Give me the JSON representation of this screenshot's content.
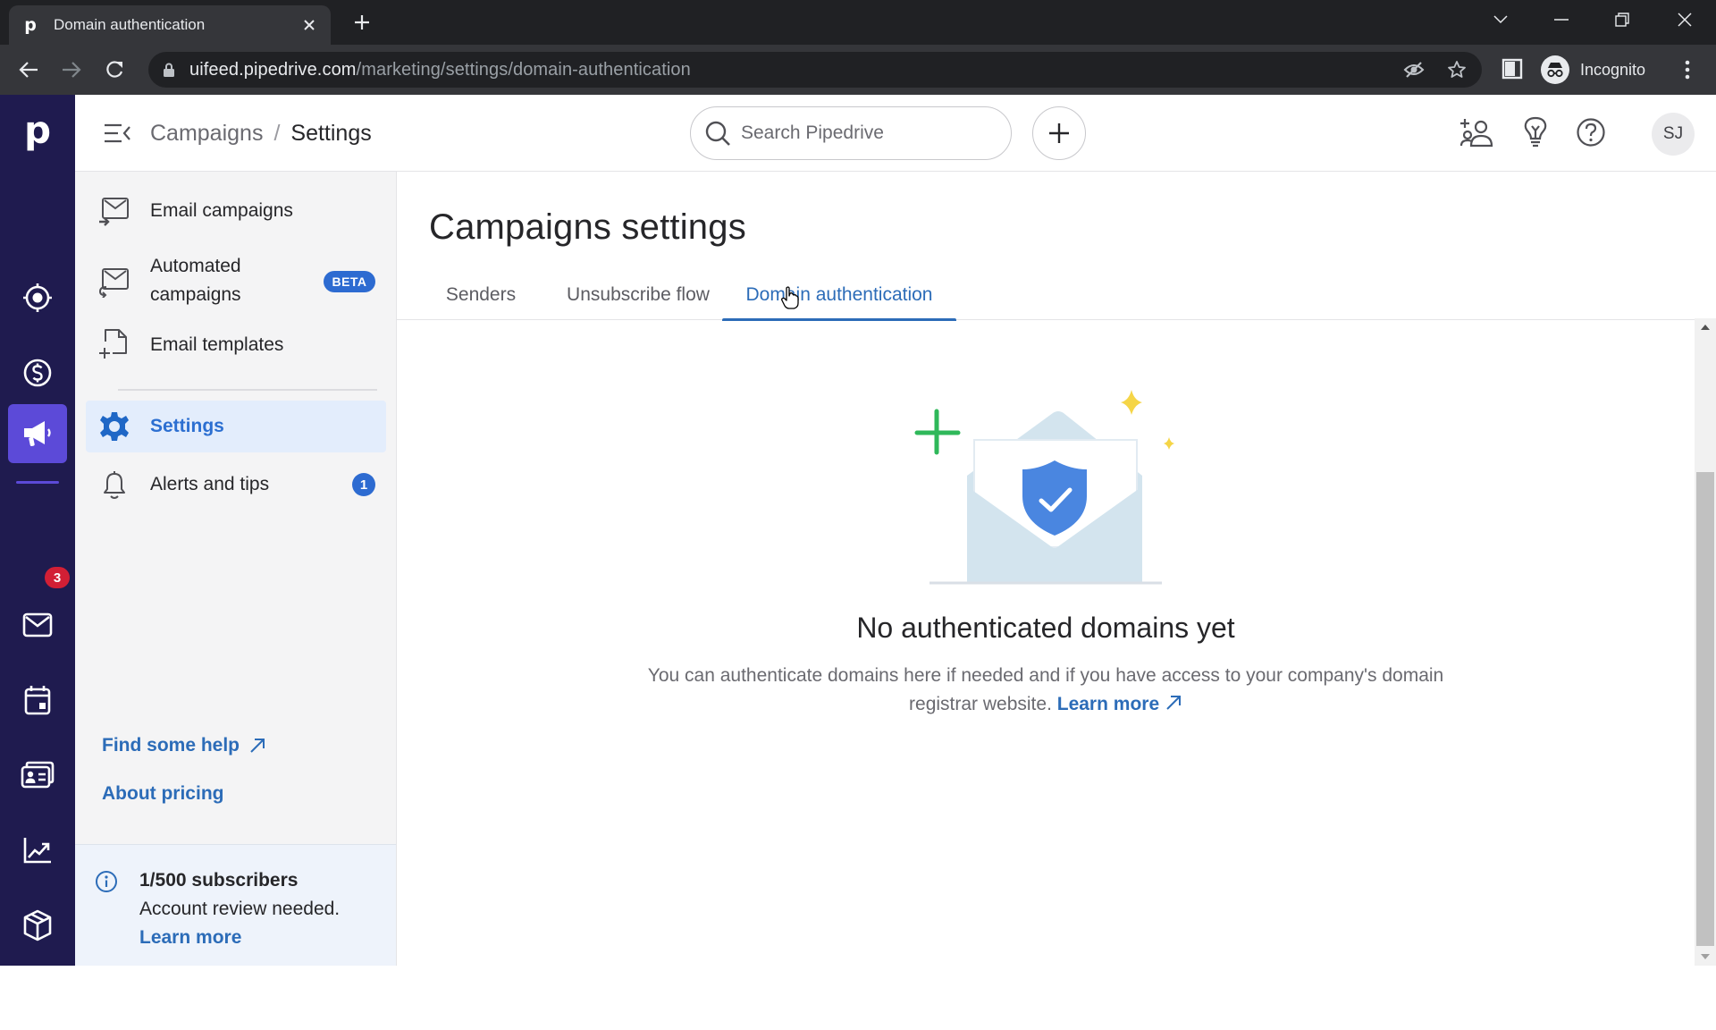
{
  "browser": {
    "tab_title": "Domain authentication",
    "tab_favicon": "p",
    "url_host": "uifeed.pipedrive.com",
    "url_path": "/marketing/settings/domain-authentication",
    "profile_label": "Incognito"
  },
  "appbar": {
    "breadcrumb_parent": "Campaigns",
    "breadcrumb_separator": "/",
    "breadcrumb_current": "Settings",
    "search_placeholder": "Search Pipedrive",
    "avatar_initials": "SJ"
  },
  "rail": {
    "logo": "p",
    "activities_badge": "3",
    "items": [
      {
        "name": "leads",
        "icon": "target-icon"
      },
      {
        "name": "deals",
        "icon": "dollar-icon"
      },
      {
        "name": "activities-tasks",
        "icon": "clipboard-check-icon"
      },
      {
        "name": "campaigns",
        "icon": "megaphone-icon",
        "active": true
      },
      {
        "name": "mail",
        "icon": "mail-icon"
      },
      {
        "name": "calendar",
        "icon": "calendar-icon"
      },
      {
        "name": "contacts",
        "icon": "contact-card-icon"
      },
      {
        "name": "insights",
        "icon": "chart-trend-icon"
      },
      {
        "name": "products",
        "icon": "box-icon"
      },
      {
        "name": "marketplace",
        "icon": "store-icon"
      }
    ]
  },
  "subnav": {
    "items": [
      {
        "label": "Email campaigns"
      },
      {
        "label": "Automated campaigns",
        "label_line1": "Automated",
        "label_line2": "campaigns",
        "badge": "BETA"
      },
      {
        "label": "Email templates"
      },
      {
        "label": "Settings",
        "active": true
      },
      {
        "label": "Alerts and tips",
        "count": "1"
      }
    ],
    "find_help": "Find some help",
    "about_pricing": "About pricing",
    "info": {
      "title": "1/500 subscribers",
      "text": "Account review needed.",
      "link": "Learn more"
    }
  },
  "main": {
    "title": "Campaigns settings",
    "tabs": [
      {
        "label": "Senders"
      },
      {
        "label": "Unsubscribe flow"
      },
      {
        "label": "Domain authentication",
        "active": true
      }
    ],
    "empty_state": {
      "title": "No authenticated domains yet",
      "description": "You can authenticate domains here if needed and if you have access to your company's domain registrar website.",
      "link": "Learn more"
    }
  },
  "colors": {
    "rail_bg": "#1f1b4f",
    "rail_active": "#5c4ad8",
    "accent_blue": "#2c6cb8",
    "badge_red": "#d21f35",
    "illustration_green": "#2fb85a",
    "illustration_yellow": "#f5d547",
    "shield_blue": "#4a86e0"
  }
}
